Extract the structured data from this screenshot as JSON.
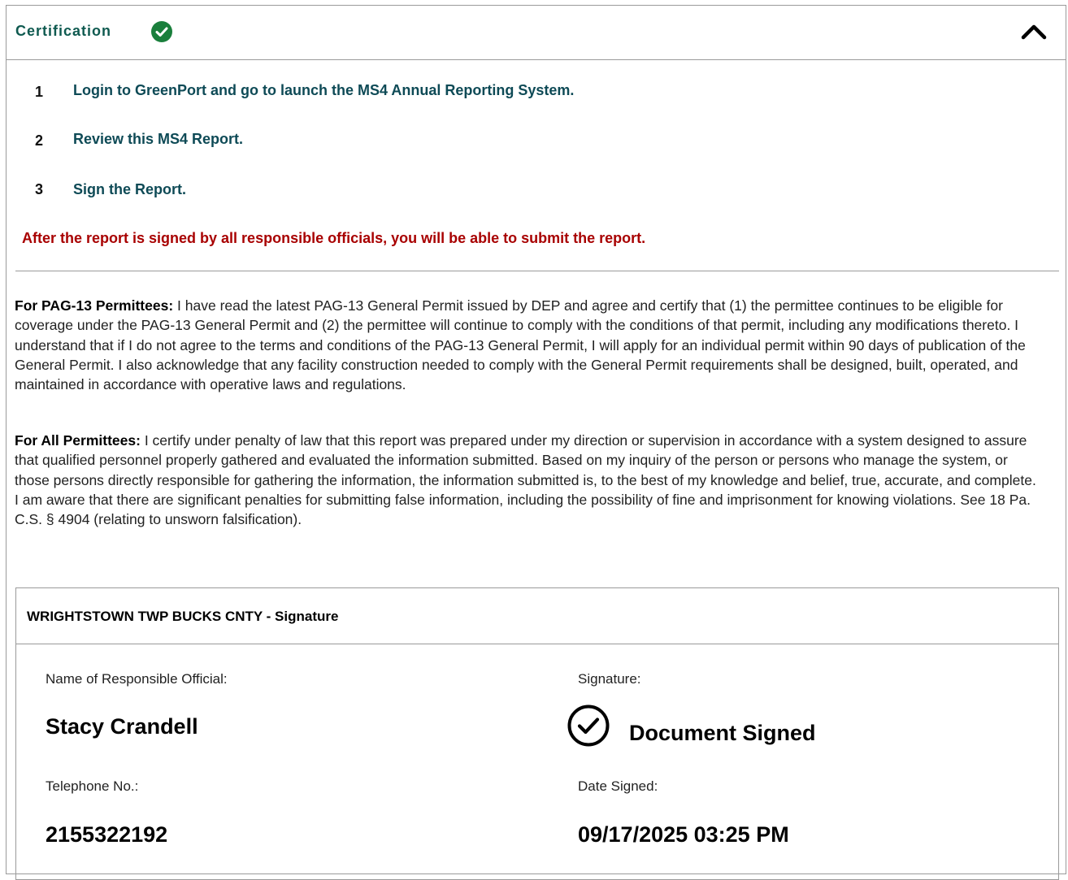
{
  "certification": {
    "title": "Certification",
    "status_icon": "check-circle-icon",
    "status_color": "#1a7f3c",
    "collapse_icon": "chevron-up-icon",
    "steps": [
      {
        "number": "1",
        "text": "Login to GreenPort and go to launch the MS4 Annual Reporting System."
      },
      {
        "number": "2",
        "text": "Review this MS4 Report."
      },
      {
        "number": "3",
        "text": "Sign the Report."
      }
    ],
    "warning": "After the report is signed by all responsible officials, you will be able to submit the report.",
    "pag13": {
      "heading": "For PAG-13 Permittees:",
      "text": "I have read the latest PAG-13 General Permit issued by DEP and agree and certify that (1) the permittee continues to be eligible for coverage under the PAG-13 General Permit and (2) the permittee will continue to comply with the conditions of that permit, including any modifications thereto. I understand that if I do not agree to the terms and conditions of the PAG-13 General Permit, I will apply for an individual permit within 90 days of publication of the General Permit. I also acknowledge that any facility construction needed to comply with the General Permit requirements shall be designed, built, operated, and maintained in accordance with operative laws and regulations."
    },
    "all_permittees": {
      "heading": "For All Permittees:",
      "text": "I certify under penalty of law that this report was prepared under my direction or supervision in accordance with a system designed to assure that qualified personnel properly gathered and evaluated the information submitted. Based on my inquiry of the person or persons who manage the system, or those persons directly responsible for gathering the information, the information submitted is, to the best of my knowledge and belief, true, accurate, and complete. I am aware that there are significant penalties for submitting false information, including the possibility of fine and imprisonment for knowing violations. See 18 Pa. C.S. § 4904 (relating to unsworn falsification)."
    }
  },
  "signature": {
    "title": "WRIGHTSTOWN TWP BUCKS CNTY - Signature",
    "name_label": "Name of Responsible Official:",
    "name_value": "Stacy Crandell",
    "signature_label": "Signature:",
    "signature_icon": "check-circle-outline-icon",
    "signature_value": "Document Signed",
    "phone_label": "Telephone No.:",
    "phone_value": "2155322192",
    "date_label": "Date Signed:",
    "date_value": "09/17/2025 03:25 PM"
  }
}
